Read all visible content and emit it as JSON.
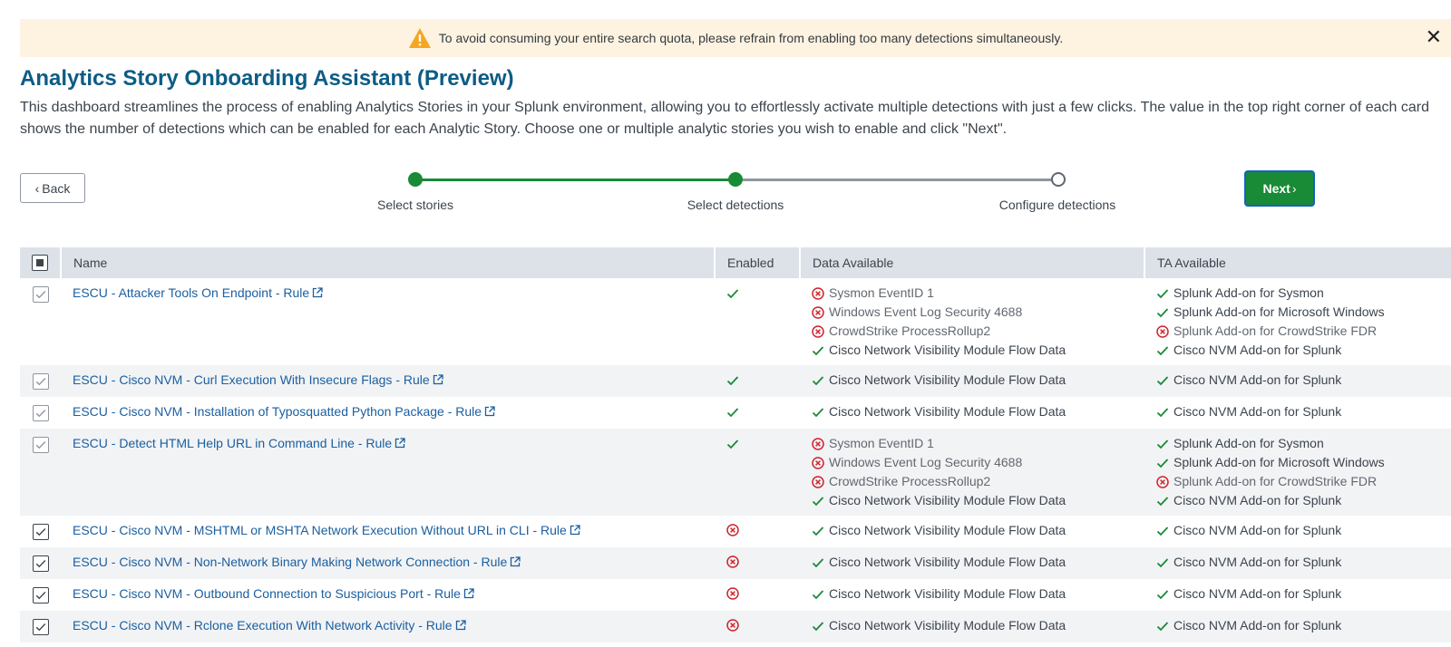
{
  "banner": {
    "message": "To avoid consuming your entire search quota, please refrain from enabling too many detections simultaneously."
  },
  "page": {
    "title": "Analytics Story Onboarding Assistant (Preview)",
    "description": "This dashboard streamlines the process of enabling Analytics Stories in your Splunk environment, allowing you to effortlessly activate multiple detections with just a few clicks. The value in the top right corner of each card shows the number of detections which can be enabled for each Analytic Story. Choose one or multiple analytic stories you wish to enable and click \"Next\"."
  },
  "nav": {
    "back_label": "Back",
    "next_label": "Next"
  },
  "steps": [
    {
      "label": "Select stories",
      "state": "complete"
    },
    {
      "label": "Select detections",
      "state": "current"
    },
    {
      "label": "Configure detections",
      "state": "pending"
    }
  ],
  "table": {
    "headers": {
      "name": "Name",
      "enabled": "Enabled",
      "data": "Data Available",
      "ta": "TA Available"
    },
    "rows": [
      {
        "name": "ESCU - Attacker Tools On Endpoint - Rule",
        "enabled": true,
        "data": [
          {
            "label": "Sysmon EventID 1",
            "ok": false
          },
          {
            "label": "Windows Event Log Security 4688",
            "ok": false
          },
          {
            "label": "CrowdStrike ProcessRollup2",
            "ok": false
          },
          {
            "label": "Cisco Network Visibility Module Flow Data",
            "ok": true
          }
        ],
        "ta": [
          {
            "label": "Splunk Add-on for Sysmon",
            "ok": true
          },
          {
            "label": "Splunk Add-on for Microsoft Windows",
            "ok": true
          },
          {
            "label": "Splunk Add-on for CrowdStrike FDR",
            "ok": false
          },
          {
            "label": "Cisco NVM Add-on for Splunk",
            "ok": true
          }
        ]
      },
      {
        "name": "ESCU - Cisco NVM - Curl Execution With Insecure Flags - Rule",
        "enabled": true,
        "data": [
          {
            "label": "Cisco Network Visibility Module Flow Data",
            "ok": true
          }
        ],
        "ta": [
          {
            "label": "Cisco NVM Add-on for Splunk",
            "ok": true
          }
        ]
      },
      {
        "name": "ESCU - Cisco NVM - Installation of Typosquatted Python Package - Rule",
        "enabled": true,
        "data": [
          {
            "label": "Cisco Network Visibility Module Flow Data",
            "ok": true
          }
        ],
        "ta": [
          {
            "label": "Cisco NVM Add-on for Splunk",
            "ok": true
          }
        ]
      },
      {
        "name": "ESCU - Detect HTML Help URL in Command Line - Rule",
        "enabled": true,
        "data": [
          {
            "label": "Sysmon EventID 1",
            "ok": false
          },
          {
            "label": "Windows Event Log Security 4688",
            "ok": false
          },
          {
            "label": "CrowdStrike ProcessRollup2",
            "ok": false
          },
          {
            "label": "Cisco Network Visibility Module Flow Data",
            "ok": true
          }
        ],
        "ta": [
          {
            "label": "Splunk Add-on for Sysmon",
            "ok": true
          },
          {
            "label": "Splunk Add-on for Microsoft Windows",
            "ok": true
          },
          {
            "label": "Splunk Add-on for CrowdStrike FDR",
            "ok": false
          },
          {
            "label": "Cisco NVM Add-on for Splunk",
            "ok": true
          }
        ]
      },
      {
        "name": "ESCU - Cisco NVM - MSHTML or MSHTA Network Execution Without URL in CLI - Rule",
        "enabled": false,
        "data": [
          {
            "label": "Cisco Network Visibility Module Flow Data",
            "ok": true
          }
        ],
        "ta": [
          {
            "label": "Cisco NVM Add-on for Splunk",
            "ok": true
          }
        ]
      },
      {
        "name": "ESCU - Cisco NVM - Non-Network Binary Making Network Connection - Rule",
        "enabled": false,
        "data": [
          {
            "label": "Cisco Network Visibility Module Flow Data",
            "ok": true
          }
        ],
        "ta": [
          {
            "label": "Cisco NVM Add-on for Splunk",
            "ok": true
          }
        ]
      },
      {
        "name": "ESCU - Cisco NVM - Outbound Connection to Suspicious Port - Rule",
        "enabled": false,
        "data": [
          {
            "label": "Cisco Network Visibility Module Flow Data",
            "ok": true
          }
        ],
        "ta": [
          {
            "label": "Cisco NVM Add-on for Splunk",
            "ok": true
          }
        ]
      },
      {
        "name": "ESCU - Cisco NVM - Rclone Execution With Network Activity - Rule",
        "enabled": false,
        "data": [
          {
            "label": "Cisco Network Visibility Module Flow Data",
            "ok": true
          }
        ],
        "ta": [
          {
            "label": "Cisco NVM Add-on for Splunk",
            "ok": true
          }
        ]
      }
    ]
  },
  "colors": {
    "accent_blue": "#0c5c85",
    "success_green": "#198a35",
    "error_red": "#d0222b",
    "banner_bg": "#fdf3e0"
  }
}
